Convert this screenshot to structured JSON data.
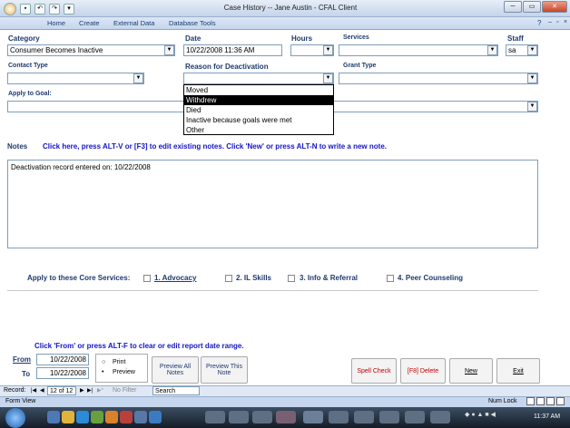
{
  "window": {
    "title": "Case History  --  Jane Austin - CFAL Client"
  },
  "ribbon": {
    "tabs": [
      "Home",
      "Create",
      "External Data",
      "Database Tools"
    ]
  },
  "form": {
    "category": {
      "label": "Category",
      "value": "Consumer Becomes Inactive"
    },
    "date": {
      "label": "Date",
      "value": "10/22/2008 11:36 AM"
    },
    "hours": {
      "label": "Hours",
      "value": ""
    },
    "services": {
      "label": "Services",
      "value": ""
    },
    "staff": {
      "label": "Staff",
      "value": "sa"
    },
    "contact_type": {
      "label": "Contact Type",
      "value": ""
    },
    "reason": {
      "label": "Reason for Deactivation",
      "value": "",
      "options": [
        "Moved",
        "Withdrew",
        "Died",
        "Inactive because goals were met",
        "Other"
      ],
      "selected": "Withdrew"
    },
    "grant_type": {
      "label": "Grant Type",
      "value": ""
    },
    "apply_goal": {
      "label": "Apply to Goal:",
      "value": ""
    }
  },
  "notes": {
    "label": "Notes",
    "message": "Click here, press ALT-V or [F3] to edit existing notes. Click 'New' or press ALT-N to write a new note.",
    "content": "Deactivation record entered on: 10/22/2008"
  },
  "core": {
    "label": "Apply to these Core Services:",
    "items": [
      "1. Advocacy",
      "2. IL Skills",
      "3. Info & Referral",
      "4. Peer Counseling"
    ]
  },
  "report": {
    "message": "Click 'From' or press ALT-F to clear or edit report date range.",
    "from_label": "From",
    "to_label": "To",
    "from": "10/22/2008",
    "to": "10/22/2008",
    "print": "Print",
    "preview": "Preview",
    "preview_all": "Preview All Notes",
    "preview_this": "Preview This Note"
  },
  "buttons": {
    "spell": "Spell Check",
    "delete": "[F8] Delete",
    "new": "New",
    "exit": "Exit"
  },
  "record_nav": {
    "label": "Record:",
    "position": "12 of 12",
    "filter": "No Filter",
    "search": "Search"
  },
  "status": {
    "left": "Form View",
    "numlock": "Num Lock"
  },
  "taskbar": {
    "clock": "11:37 AM"
  },
  "colors": {
    "label": "#1f3a6e",
    "notes_msg": "#1414c8",
    "spell": "#c00000"
  }
}
